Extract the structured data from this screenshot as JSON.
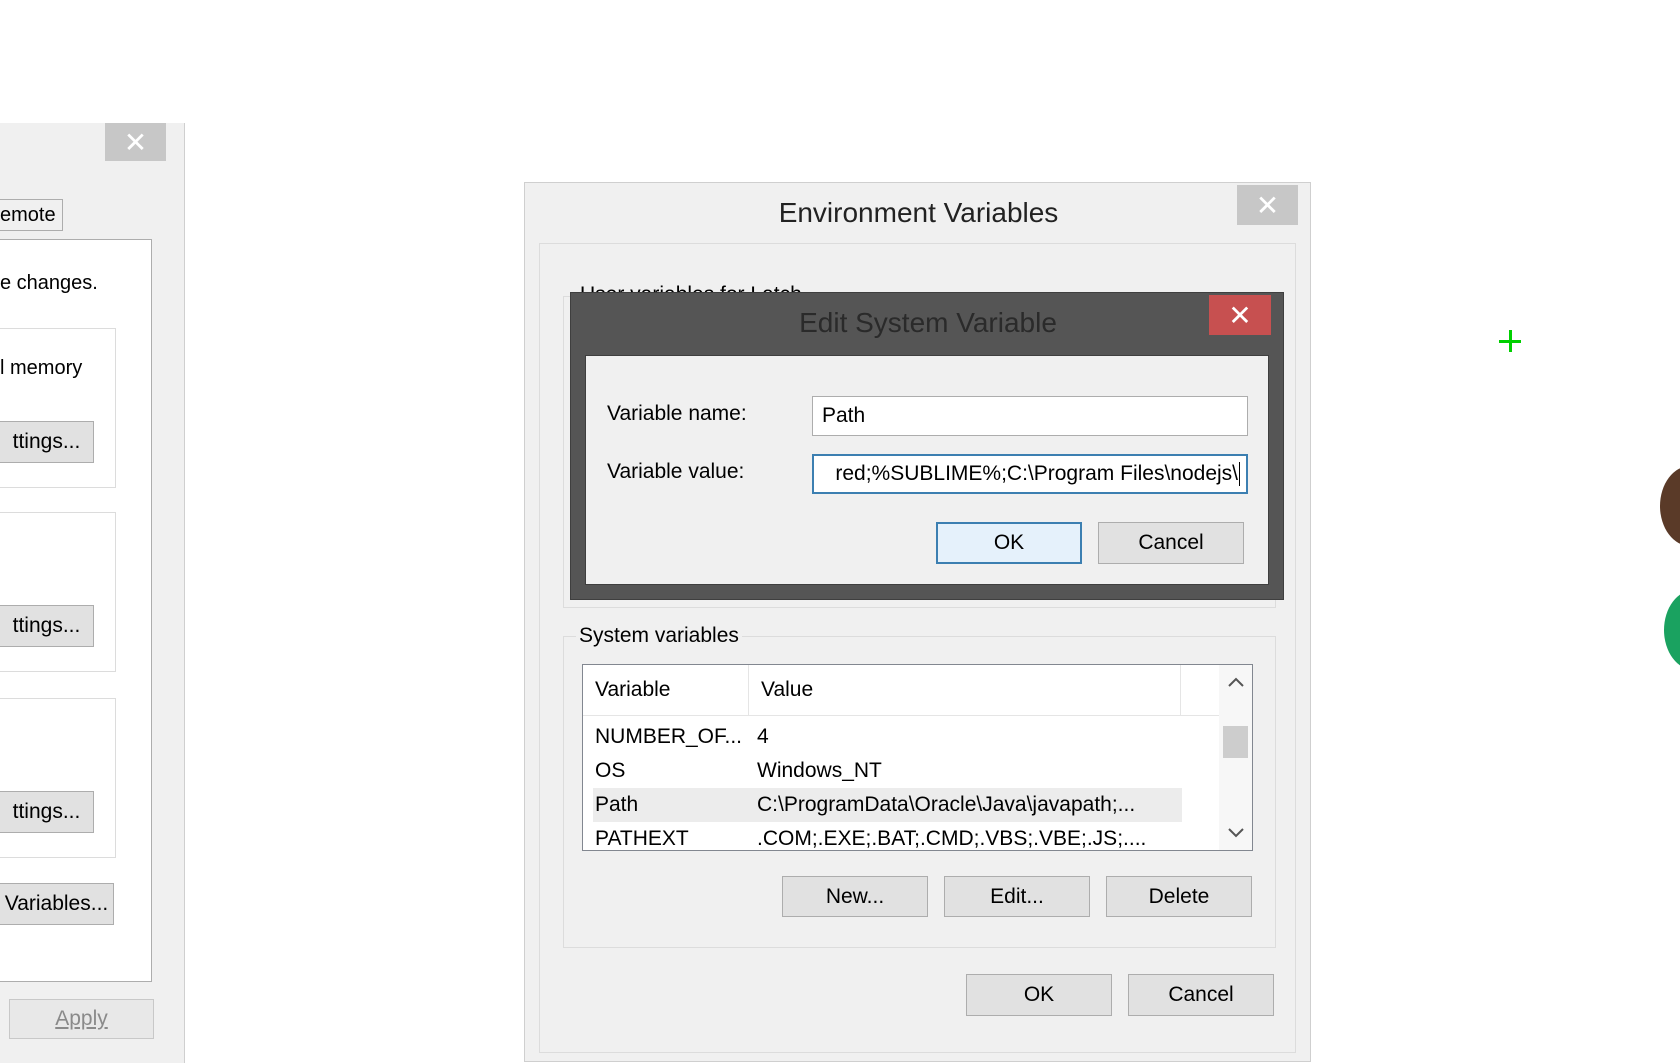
{
  "left_window": {
    "tab_label": "emote",
    "note": "e changes.",
    "group1_text": "l memory",
    "settings1": "ttings...",
    "settings2": "ttings...",
    "settings3": "ttings...",
    "env_vars_button": "Variables...",
    "apply_button": "Apply"
  },
  "env_dialog": {
    "title": "Environment Variables",
    "user_vars_label": "User variables for Latch",
    "system_vars_label": "System variables",
    "columns": [
      "Variable",
      "Value"
    ],
    "rows": [
      {
        "name": "NUMBER_OF...",
        "value": "4"
      },
      {
        "name": "OS",
        "value": "Windows_NT"
      },
      {
        "name": "Path",
        "value": "C:\\ProgramData\\Oracle\\Java\\javapath;..."
      },
      {
        "name": "PATHEXT",
        "value": ".COM;.EXE;.BAT;.CMD;.VBS;.VBE;.JS;...."
      }
    ],
    "new_button": "New...",
    "edit_button": "Edit...",
    "delete_button": "Delete",
    "ok_button": "OK",
    "cancel_button": "Cancel"
  },
  "edit_dialog": {
    "title": "Edit System Variable",
    "name_label": "Variable name:",
    "value_label": "Variable value:",
    "name_value": "Path",
    "value_value": "red;%SUBLIME%;C:\\Program Files\\nodejs\\",
    "ok_button": "OK",
    "cancel_button": "Cancel"
  },
  "icons": {
    "close": "close-icon",
    "scroll_up": "chevron-up-icon",
    "scroll_down": "chevron-down-icon",
    "cursor": "crosshair-cursor-icon"
  },
  "colors": {
    "close_active": "#c75050",
    "close_inactive": "#c7c7c7",
    "focus_border": "#3c7fb1",
    "cursor": "#00d000"
  }
}
